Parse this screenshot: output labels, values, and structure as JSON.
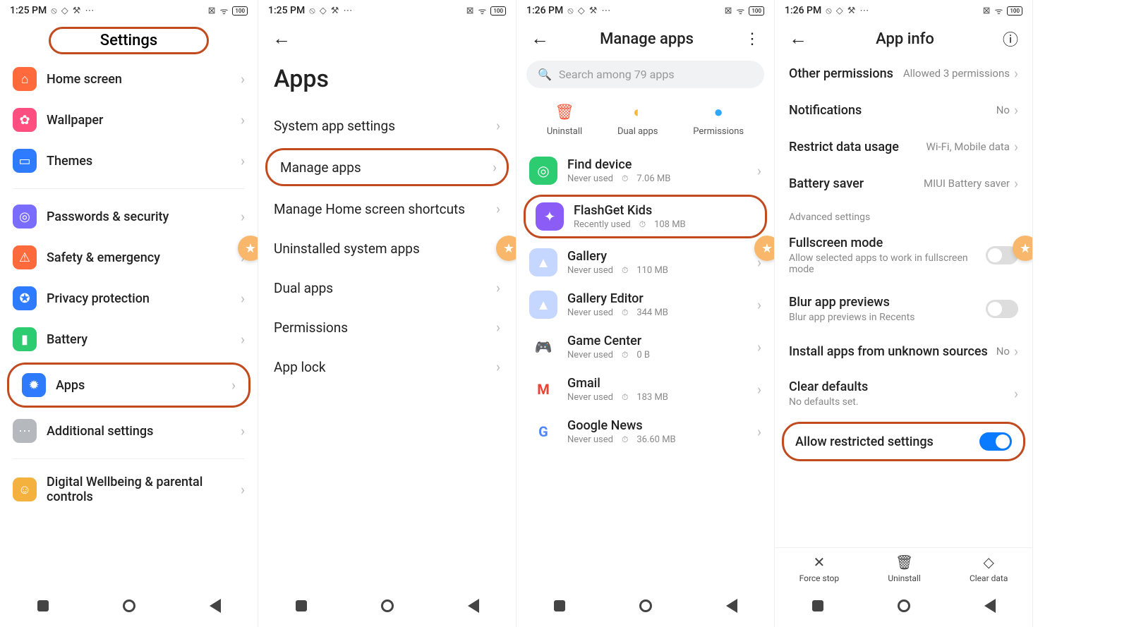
{
  "status": {
    "times": [
      "1:25 PM",
      "1:25 PM",
      "1:26 PM",
      "1:26 PM"
    ],
    "battery": "100"
  },
  "screen1": {
    "title": "Settings",
    "items": [
      {
        "label": "Home screen",
        "color": "#ff6a3d",
        "glyph": "⌂"
      },
      {
        "label": "Wallpaper",
        "color": "#ff4f81",
        "glyph": "✿"
      },
      {
        "label": "Themes",
        "color": "#2f7bff",
        "glyph": "▭"
      }
    ],
    "items2": [
      {
        "label": "Passwords & security",
        "color": "#7a6cff",
        "glyph": "◎"
      },
      {
        "label": "Safety & emergency",
        "color": "#ff6a3d",
        "glyph": "⚠"
      },
      {
        "label": "Privacy protection",
        "color": "#2f7bff",
        "glyph": "✪"
      },
      {
        "label": "Battery",
        "color": "#2ecc71",
        "glyph": "▮"
      },
      {
        "label": "Apps",
        "color": "#2f7bff",
        "glyph": "✹"
      },
      {
        "label": "Additional settings",
        "color": "#b5b8bd",
        "glyph": "⋯"
      }
    ],
    "items3": [
      {
        "label": "Digital Wellbeing & parental controls",
        "color": "#f5b13d",
        "glyph": "☺"
      }
    ]
  },
  "screen2": {
    "title": "Apps",
    "rows": [
      "System app settings",
      "Manage apps",
      "Manage Home screen shortcuts",
      "Uninstalled system apps",
      "Dual apps",
      "Permissions",
      "App lock"
    ]
  },
  "screen3": {
    "title": "Manage apps",
    "search_placeholder": "Search among 79 apps",
    "actions": [
      {
        "label": "Uninstall",
        "color": "#ff5a3d",
        "glyph": "🗑"
      },
      {
        "label": "Dual apps",
        "color": "#f6b93b",
        "glyph": "◐"
      },
      {
        "label": "Permissions",
        "color": "#30a7ff",
        "glyph": "●"
      }
    ],
    "apps": [
      {
        "name": "Find device",
        "usage": "Never used",
        "size": "7.06 MB",
        "color": "#2ecc71",
        "glyph": "◎"
      },
      {
        "name": "FlashGet Kids",
        "usage": "Recently used",
        "size": "108 MB",
        "color": "#8b5cf6",
        "glyph": "✦"
      },
      {
        "name": "Gallery",
        "usage": "Never used",
        "size": "110 MB",
        "color": "#93b7ff",
        "glyph": "▲"
      },
      {
        "name": "Gallery Editor",
        "usage": "Never used",
        "size": "344 MB",
        "color": "#93b7ff",
        "glyph": "▲"
      },
      {
        "name": "Game Center",
        "usage": "Never used",
        "size": "0 B",
        "color": "#30a7ff",
        "glyph": "🎮"
      },
      {
        "name": "Gmail",
        "usage": "Never used",
        "size": "183 MB",
        "color": "#fff",
        "glyph": "M"
      },
      {
        "name": "Google News",
        "usage": "Never used",
        "size": "36.60 MB",
        "color": "#4f86ff",
        "glyph": "G"
      }
    ]
  },
  "screen4": {
    "title": "App info",
    "rows1": [
      {
        "title": "Other permissions",
        "val": "Allowed 3 permissions"
      },
      {
        "title": "Notifications",
        "val": "No"
      },
      {
        "title": "Restrict data usage",
        "val": "Wi-Fi, Mobile data"
      },
      {
        "title": "Battery saver",
        "val": "MIUI Battery saver"
      }
    ],
    "adv_heading": "Advanced settings",
    "fullscreen": {
      "title": "Fullscreen mode",
      "sub": "Allow selected apps to work in fullscreen mode"
    },
    "blur": {
      "title": "Blur app previews",
      "sub": "Blur app previews in Recents"
    },
    "install": {
      "title": "Install apps from unknown sources",
      "val": "No"
    },
    "clear": {
      "title": "Clear defaults",
      "sub": "No defaults set."
    },
    "allow": "Allow restricted settings",
    "bottom": [
      {
        "label": "Force stop",
        "glyph": "✕"
      },
      {
        "label": "Uninstall",
        "glyph": "🗑"
      },
      {
        "label": "Clear data",
        "glyph": "◇"
      }
    ]
  }
}
